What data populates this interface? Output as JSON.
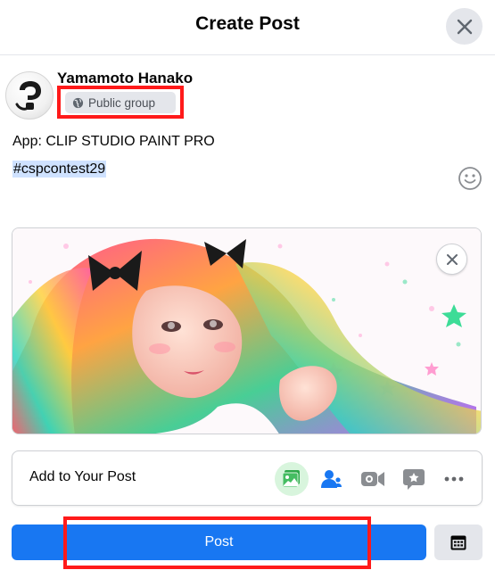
{
  "dialog": {
    "title": "Create Post"
  },
  "author": {
    "name": "Yamamoto Hanako",
    "privacy_label": "Public group",
    "privacy_icon": "globe-icon",
    "avatar_icon": "clip-studio-logo"
  },
  "post": {
    "app_line": "App: CLIP STUDIO PAINT PRO",
    "hashtag": "#cspcontest29"
  },
  "media": {
    "kind": "illustration of a girl with rainbow-colored hair and a black bow"
  },
  "add_to_post": {
    "label": "Add to Your Post",
    "options": [
      "photo-video-icon",
      "tag-people-icon",
      "live-video-icon",
      "feeling-icon",
      "more-icon"
    ]
  },
  "actions": {
    "post_label": "Post",
    "schedule_icon": "schedule-icon"
  },
  "colors": {
    "primary": "#1877f2",
    "highlight": "#ff1a1a",
    "hashtag_bg": "#cfe2ff",
    "button_gray": "#e4e6eb"
  }
}
